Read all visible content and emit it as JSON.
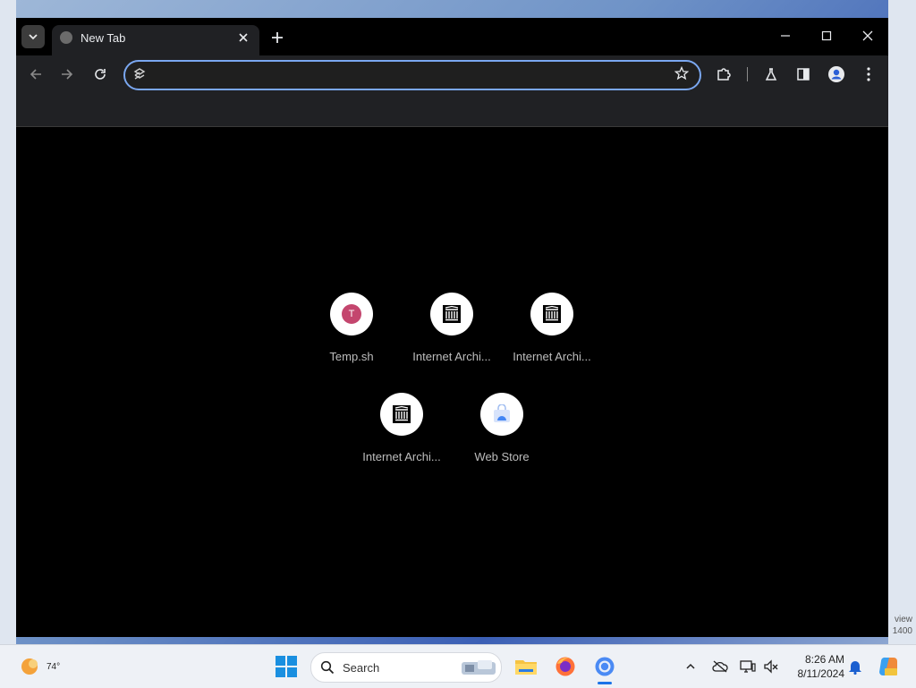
{
  "browser": {
    "tab": {
      "title": "New Tab"
    },
    "omnibox": {
      "value": "",
      "placeholder": ""
    }
  },
  "shortcuts": [
    {
      "label": "Temp.sh",
      "letter": "T"
    },
    {
      "label": "Internet Archi..."
    },
    {
      "label": "Internet Archi..."
    },
    {
      "label": "Internet Archi..."
    },
    {
      "label": "Web Store"
    }
  ],
  "taskbar": {
    "weather_temp": "74°",
    "search_label": "Search",
    "clock_time": "8:26 AM",
    "clock_date": "8/11/2024"
  },
  "desktop": {
    "watermark_line1": "view",
    "watermark_line2": "1400"
  },
  "colors": {
    "accent": "#7aa7f0",
    "tab_bg": "#202124",
    "temp_badge": "#c4466e"
  }
}
